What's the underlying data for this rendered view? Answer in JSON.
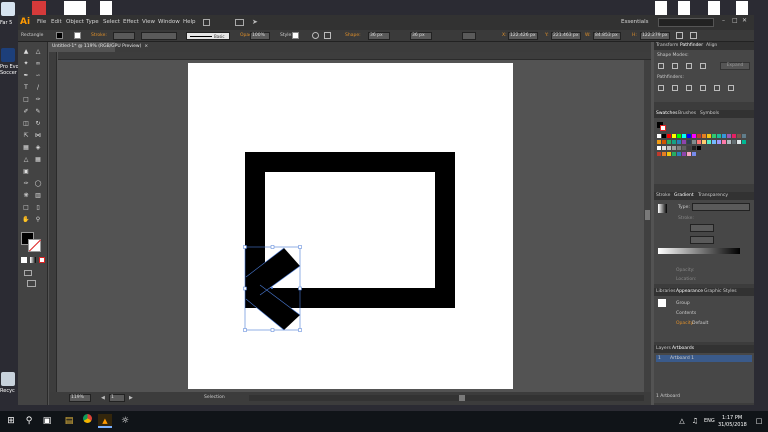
{
  "desktop": {
    "icons": [
      {
        "label": "Far 5"
      },
      {
        "label": "Pro Evo Soccer"
      },
      {
        "label": "Recyc"
      }
    ],
    "top_app_labels": []
  },
  "app": {
    "logo": "Ai",
    "menu": [
      "File",
      "Edit",
      "Object",
      "Type",
      "Select",
      "Effect",
      "View",
      "Window",
      "Help"
    ],
    "workspace": "Essentials",
    "search_placeholder": ""
  },
  "control_bar": {
    "selection_label": "Rectangle",
    "stroke_label": "Stroke:",
    "brush_label": "Basic",
    "opacity_label": "Opacity:",
    "opacity_value": "100%",
    "style_label": "Style:",
    "shape_label": "Shape:",
    "w_value": "36 px",
    "h_value": "36 px",
    "x_label": "X:",
    "x_value": "122.426 px",
    "y_label": "Y:",
    "y_value": "221.463 px",
    "w_label": "W:",
    "w2_value": "84.853 px",
    "h_label": "H:",
    "h2_value": "122.279 px"
  },
  "document": {
    "tab_title": "Untitled-1* @ 119% (RGB/GPU Preview)"
  },
  "status": {
    "zoom": "119%",
    "page": "1",
    "tool": "Selection"
  },
  "panels": {
    "top_tabs": [
      "Transform",
      "Pathfinder",
      "Align"
    ],
    "shape_modes": "Shape Modes:",
    "expand": "Expand",
    "pathfinders": "Pathfinders:",
    "swatch_tabs": [
      "Swatches",
      "Brushes",
      "Symbols"
    ],
    "stroke_tabs": [
      "Stroke",
      "Gradient",
      "Transparency"
    ],
    "gradient_type": "Type:",
    "gradient_stroke": "Stroke:",
    "gradient_opacity": "Opacity:",
    "gradient_location": "Location:",
    "appearance_tabs": [
      "Libraries",
      "Appearance",
      "Graphic Styles"
    ],
    "appearance_group": "Group",
    "appearance_contents": "Contents",
    "appearance_opacity": "Opacity:",
    "appearance_opacity_val": "Default",
    "layers_tabs": [
      "Layers",
      "Artboards"
    ],
    "artboard_row_num": "1",
    "artboard_row_name": "Artboard 1",
    "artboard_count": "1 Artboard"
  },
  "taskbar": {
    "time": "1:17 PM",
    "date": "31/05/2018",
    "lang": "ENG"
  },
  "colors": {
    "accent": "#ff9a00",
    "selection": "#4a7bd6"
  }
}
